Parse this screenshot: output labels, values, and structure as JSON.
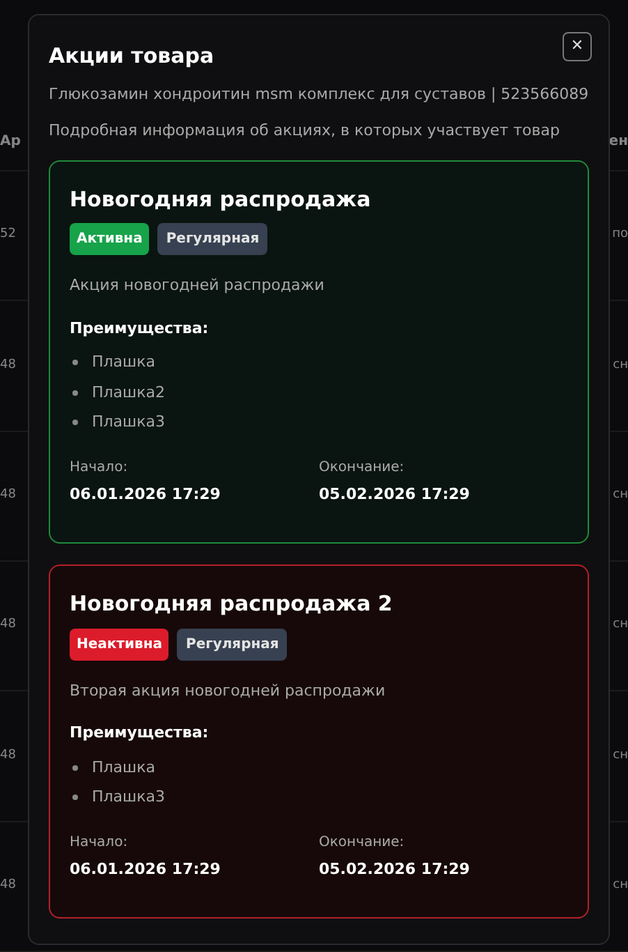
{
  "background_table": {
    "columns": [
      "Ар",
      "ен"
    ],
    "rows": [
      [
        "52",
        "по"
      ],
      [
        "48",
        "сн"
      ],
      [
        "48",
        "сн"
      ],
      [
        "48",
        "сн"
      ],
      [
        "48",
        "сн"
      ],
      [
        "48",
        "сн"
      ]
    ]
  },
  "dialog": {
    "title": "Акции товара",
    "product": "Глюкозамин хондроитин msm комплекс для суставов | 523566089",
    "description": "Подробная информация об акциях, в которых участвует товар",
    "close": "✕"
  },
  "promotions": [
    {
      "title": "Новогодняя распродажа",
      "status": {
        "label": "Активна",
        "active": true
      },
      "type": "Регулярная",
      "description": "Акция новогодней распродажи",
      "benefits_title": "Преимущества:",
      "benefits": [
        "Плашка",
        "Плашка2",
        "Плашка3"
      ],
      "start_label": "Начало:",
      "start": "06.01.2026 17:29",
      "end_label": "Окончание:",
      "end": "05.02.2026 17:29"
    },
    {
      "title": "Новогодняя распродажа 2",
      "status": {
        "label": "Неактивна",
        "active": false
      },
      "type": "Регулярная",
      "description": "Вторая акция новогодней распродажи",
      "benefits_title": "Преимущества:",
      "benefits": [
        "Плашка",
        "Плашка3"
      ],
      "start_label": "Начало:",
      "start": "06.01.2026 17:29",
      "end_label": "Окончание:",
      "end": "05.02.2026 17:29"
    }
  ]
}
